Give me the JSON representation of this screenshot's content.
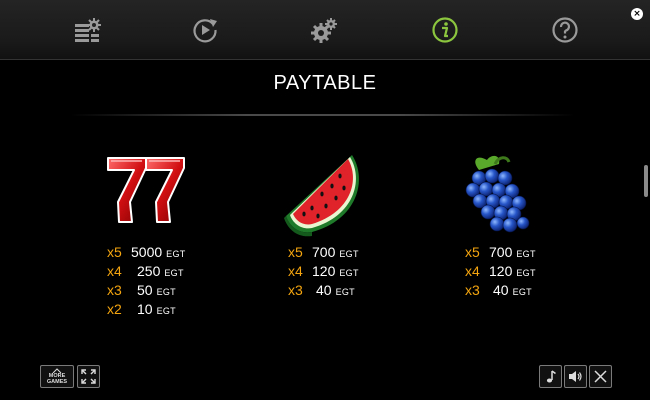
{
  "nav": {
    "items": [
      {
        "id": "paylines",
        "icon": "paylines-settings-icon",
        "active": false
      },
      {
        "id": "autoplay",
        "icon": "autoplay-icon",
        "active": false
      },
      {
        "id": "settings",
        "icon": "gear-icon",
        "active": false
      },
      {
        "id": "info",
        "icon": "info-icon",
        "active": true
      },
      {
        "id": "help",
        "icon": "help-icon",
        "active": false
      }
    ],
    "active_color": "#8cc63f",
    "inactive_color": "#9a9a9a"
  },
  "close_glyph": "×",
  "title": "PAYTABLE",
  "symbols": [
    {
      "name": "seven",
      "icon": "seven-icon",
      "pays": [
        {
          "mult": "x5",
          "amount": "5000",
          "currency": "EGT"
        },
        {
          "mult": "x4",
          "amount": "250",
          "currency": "EGT"
        },
        {
          "mult": "x3",
          "amount": "50",
          "currency": "EGT"
        },
        {
          "mult": "x2",
          "amount": "10",
          "currency": "EGT"
        }
      ]
    },
    {
      "name": "watermelon",
      "icon": "watermelon-icon",
      "pays": [
        {
          "mult": "x5",
          "amount": "700",
          "currency": "EGT"
        },
        {
          "mult": "x4",
          "amount": "120",
          "currency": "EGT"
        },
        {
          "mult": "x3",
          "amount": "40",
          "currency": "EGT"
        }
      ]
    },
    {
      "name": "grapes",
      "icon": "grapes-icon",
      "pays": [
        {
          "mult": "x5",
          "amount": "700",
          "currency": "EGT"
        },
        {
          "mult": "x4",
          "amount": "120",
          "currency": "EGT"
        },
        {
          "mult": "x3",
          "amount": "40",
          "currency": "EGT"
        }
      ]
    }
  ],
  "footer": {
    "more_games_line1": "MORE",
    "more_games_line2": "GAMES",
    "fullscreen_icon": "fullscreen-icon",
    "music_icon": "music-note-icon",
    "sound_icon": "speaker-icon",
    "close_icon": "close-icon"
  },
  "colors": {
    "multiplier": "#f4a50f",
    "text": "#ffffff",
    "background": "#000000"
  }
}
